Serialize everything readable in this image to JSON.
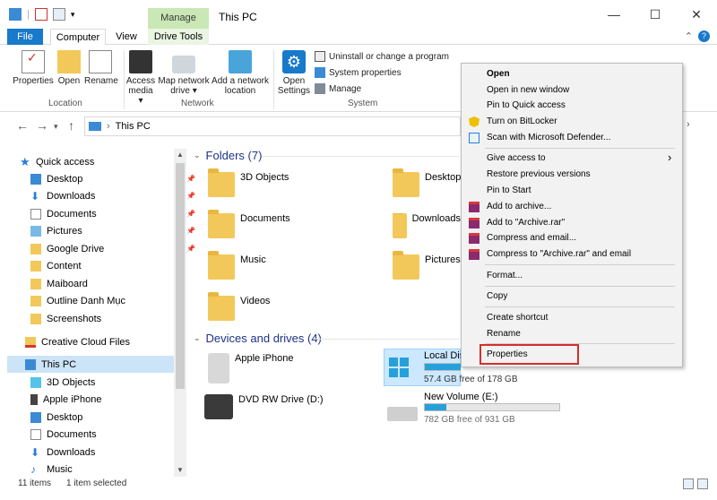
{
  "window": {
    "title": "This PC",
    "contextual_tab": "Manage",
    "minimize": "—",
    "maximize": "☐",
    "close": "✕"
  },
  "tabs": {
    "file": "File",
    "computer": "Computer",
    "view": "View",
    "drive_tools": "Drive Tools"
  },
  "ribbon": {
    "properties": "Properties",
    "open": "Open",
    "rename": "Rename",
    "access_media_1": "Access",
    "access_media_2": "media ▾",
    "map_drive_1": "Map network",
    "map_drive_2": "drive ▾",
    "add_location_1": "Add a network",
    "add_location_2": "location",
    "open_settings_1": "Open",
    "open_settings_2": "Settings",
    "uninstall": "Uninstall or change a program",
    "system_properties": "System properties",
    "manage": "Manage",
    "grp_location": "Location",
    "grp_network": "Network",
    "grp_system": "System"
  },
  "address": {
    "path": "This PC"
  },
  "nav": {
    "quick_access": "Quick access",
    "items": [
      "Desktop",
      "Downloads",
      "Documents",
      "Pictures",
      "Google Drive",
      "Content",
      "Maiboard",
      "Outline Danh Mục",
      "Screenshots"
    ],
    "creative_cloud": "Creative Cloud Files",
    "this_pc": "This PC",
    "pc_items": [
      "3D Objects",
      "Apple iPhone",
      "Desktop",
      "Documents",
      "Downloads",
      "Music"
    ]
  },
  "content": {
    "folders_header": "Folders (7)",
    "folders": [
      "3D Objects",
      "Desktop",
      "Documents",
      "Downloads",
      "Music",
      "Pictures",
      "Videos"
    ],
    "devices_header": "Devices and drives (4)",
    "apple_iphone": "Apple iPhone",
    "dvd": "DVD RW Drive (D:)",
    "local_disk": "Local Disk",
    "local_free": "57.4 GB free of 178 GB",
    "local_fill": 0.68,
    "new_volume": "New Volume (E:)",
    "new_free": "782 GB free of 931 GB",
    "new_fill": 0.16
  },
  "context_menu": {
    "items": [
      "Open",
      "Open in new window",
      "Pin to Quick access",
      "Turn on BitLocker",
      "Scan with Microsoft Defender...",
      "Give access to",
      "Restore previous versions",
      "Pin to Start",
      "Add to archive...",
      "Add to \"Archive.rar\"",
      "Compress and email...",
      "Compress to \"Archive.rar\" and email",
      "Format...",
      "Copy",
      "Create shortcut",
      "Rename",
      "Properties"
    ],
    "submenu_arrow": "›"
  },
  "status": {
    "count": "11 items",
    "selected": "1 item selected"
  },
  "colors": {
    "accent": "#1979ca",
    "folder": "#f3c85a",
    "highlight": "#d62d2d",
    "bar": "#26a0da"
  }
}
